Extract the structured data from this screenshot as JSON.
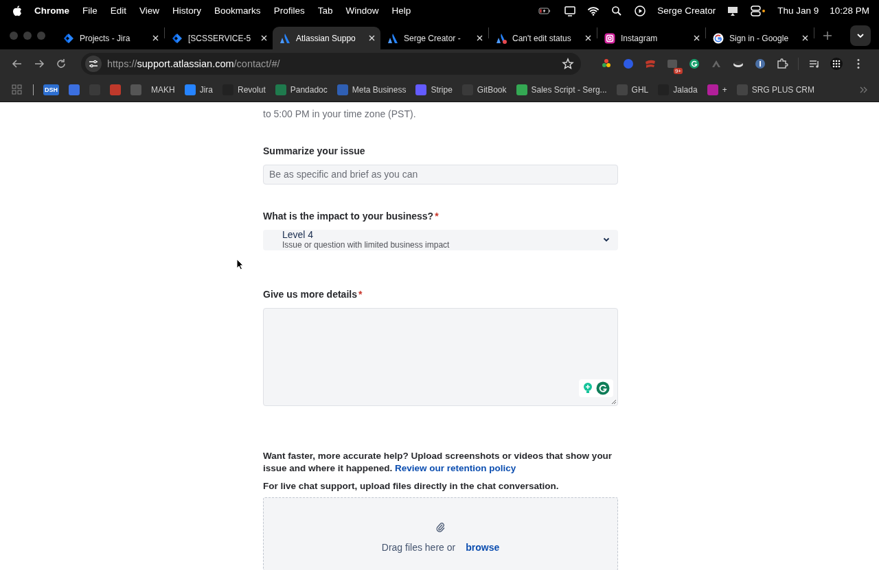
{
  "menu_bar": {
    "app": "Chrome",
    "menus": [
      "File",
      "Edit",
      "View",
      "History",
      "Bookmarks",
      "Profiles",
      "Tab",
      "Window",
      "Help"
    ],
    "user": "Serge Creator",
    "date": "Thu Jan 9",
    "time": "10:28 PM"
  },
  "tabs": [
    {
      "kind": "jira",
      "title": "Projects - Jira",
      "selected": false
    },
    {
      "kind": "jira",
      "title": "[SCSSERVICE-5",
      "selected": false
    },
    {
      "kind": "atlassian",
      "title": "Atlassian Suppo",
      "selected": true
    },
    {
      "kind": "atlassian",
      "title": "Serge Creator -",
      "selected": false
    },
    {
      "kind": "atlassian-alert",
      "title": "Can't edit status",
      "selected": false
    },
    {
      "kind": "instagram",
      "title": "Instagram",
      "selected": false
    },
    {
      "kind": "google",
      "title": "Sign in - Google",
      "selected": false
    }
  ],
  "address_bar": {
    "scheme": "https://",
    "host": "support.atlassian.com",
    "path": "/contact/#/",
    "extension_badge": "9+"
  },
  "bookmarks": [
    {
      "color": "#2d6fd1",
      "label": "DSH"
    },
    {
      "color": "#3b6fe0"
    },
    {
      "color": "#3a3a3a"
    },
    {
      "color": "#c0392b"
    },
    {
      "color": "#555555"
    },
    {
      "label": "MAKH"
    },
    {
      "color": "#2684ff",
      "label": "Jira"
    },
    {
      "color": "#222222",
      "label": "Revolut"
    },
    {
      "color": "#1f7a4d",
      "label": "Pandadoc"
    },
    {
      "color": "#2f5fb3",
      "label": "Meta Business"
    },
    {
      "color": "#635bff",
      "label": "Stripe"
    },
    {
      "color": "#3a3a3a",
      "label": "GitBook"
    },
    {
      "color": "#34a853",
      "label": "Sales Script - Serg..."
    },
    {
      "color": "#444444",
      "label": "GHL"
    },
    {
      "color": "#222222",
      "label": "Jalada"
    },
    {
      "color": "#b21f9a",
      "label": "+"
    },
    {
      "color": "#444444",
      "label": "SRG PLUS CRM"
    }
  ],
  "form": {
    "intro": "to 5:00 PM in your time zone (PST).",
    "fields": [
      {
        "kind": "text",
        "label": "Summarize your issue",
        "placeholder": "Be as specific and brief as you can"
      },
      {
        "kind": "select",
        "label": "What is the impact to your business?",
        "required_mark": "*",
        "value": "Level 4",
        "description": "Issue or question with limited business impact"
      },
      {
        "kind": "textarea",
        "label": "Give us more details",
        "required_mark": "*"
      }
    ],
    "upload_note": "Want faster, more accurate help? Upload screenshots or videos that show your issue and where it happened. ",
    "retention_link": "Review our retention policy",
    "live_chat_note": "For live chat support, upload files directly in the chat conversation.",
    "dropzone": {
      "text": "Drag files here or",
      "link": "browse"
    }
  }
}
